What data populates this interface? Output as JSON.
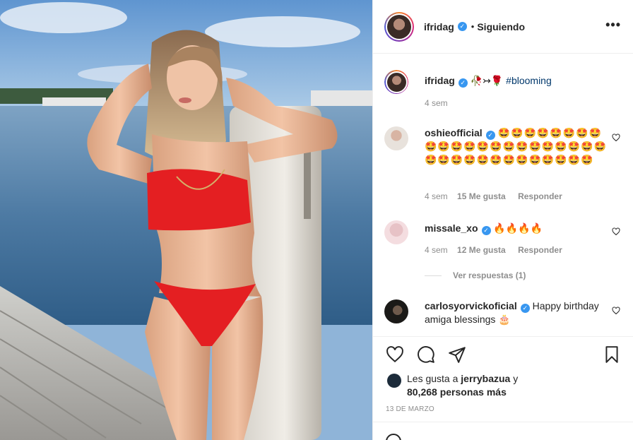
{
  "post": {
    "author": "ifridag",
    "follow_sep": "•",
    "follow_status": "Siguiendo",
    "more_label": "•••",
    "image_icon": "photo-of-woman-in-red-bikini-on-dock"
  },
  "caption": {
    "username": "ifridag",
    "emojis": "🥀↣🌹",
    "hashtag": "#blooming",
    "time": "4 sem"
  },
  "comments": [
    {
      "username": "oshieofficial",
      "verified": true,
      "text": "🤩🤩🤩🤩🤩🤩🤩🤩🤩🤩🤩🤩🤩🤩🤩🤩🤩🤩🤩🤩🤩🤩🤩🤩🤩🤩🤩🤩🤩🤩🤩🤩🤩🤩🤩",
      "time": "4 sem",
      "likes": "15 Me gusta",
      "reply": "Responder"
    },
    {
      "username": "missale_xo",
      "verified": true,
      "text": "🔥🔥🔥🔥",
      "time": "4 sem",
      "likes": "12 Me gusta",
      "reply": "Responder",
      "view_replies": "Ver respuestas (1)"
    },
    {
      "username": "carlosyorvickoficial",
      "verified": true,
      "text": "Happy birthday amiga blessings 🎂"
    }
  ],
  "likes": {
    "prefix": "Les gusta a",
    "user": "jerrybazua",
    "connector": "y",
    "others": "80,268 personas más"
  },
  "date": "13 DE MARZO",
  "colors": {
    "verified": "#3897f0",
    "hashtag": "#00376b",
    "muted": "#8e8e8e",
    "bikini": "#e41f22"
  }
}
